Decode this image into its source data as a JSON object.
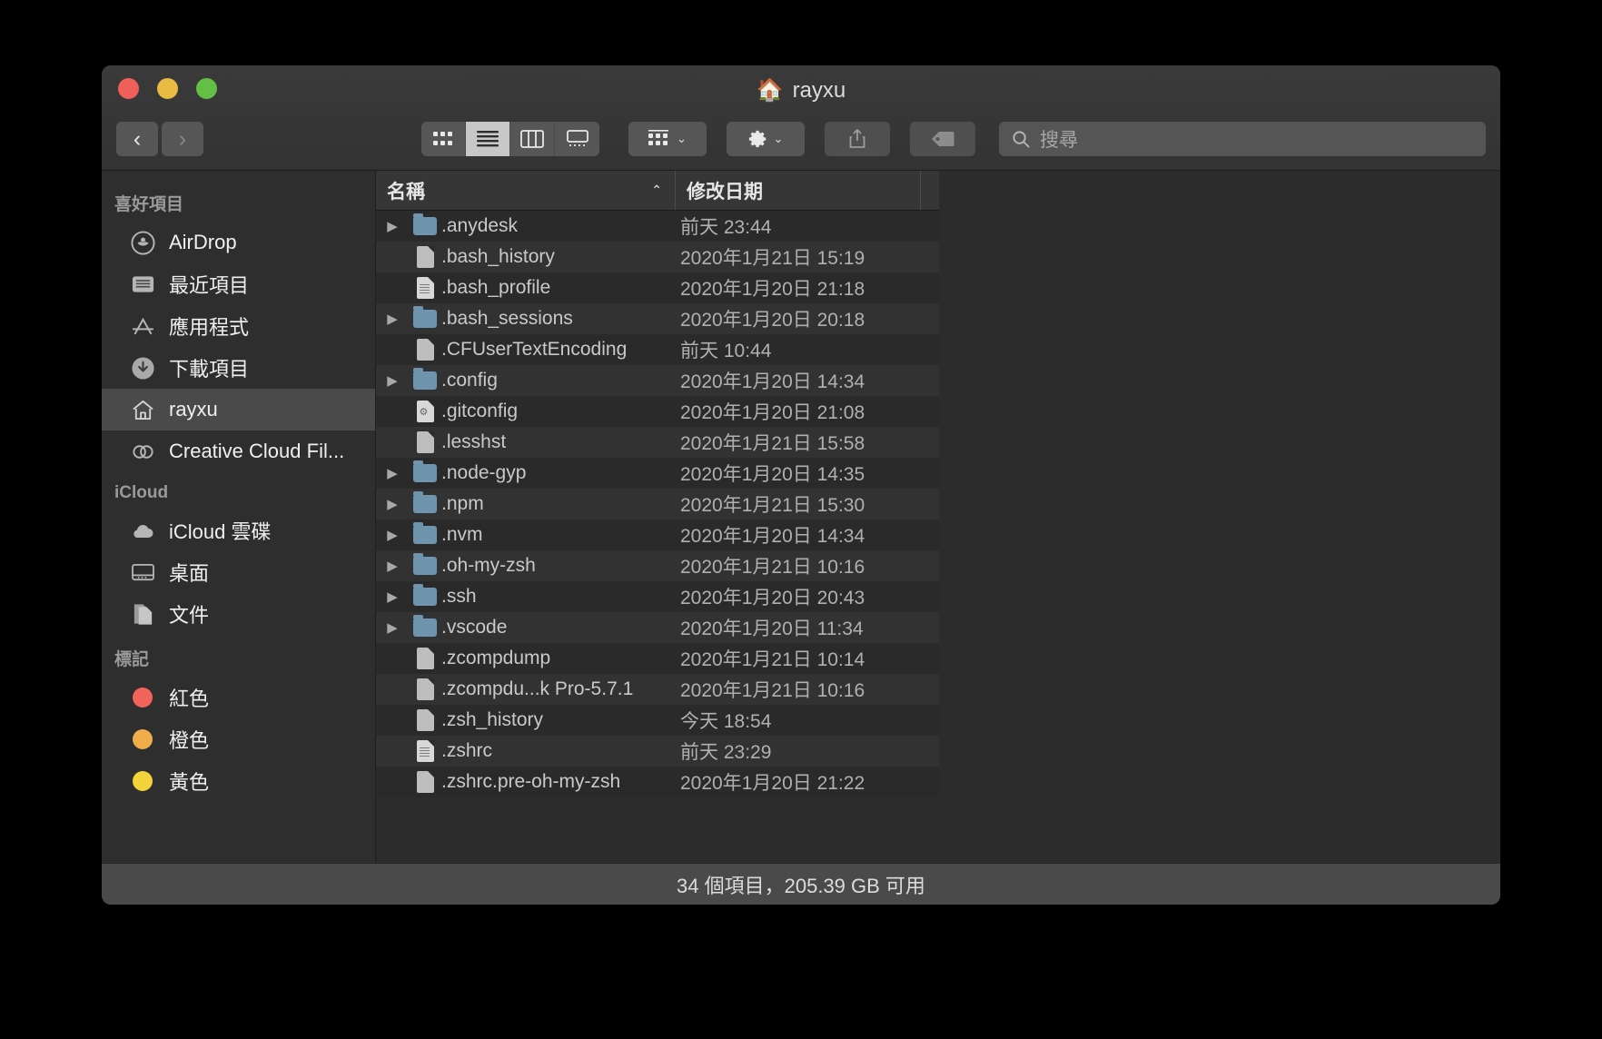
{
  "window": {
    "title": "rayxu",
    "title_icon": "home-icon"
  },
  "toolbar": {
    "back_label": "‹",
    "forward_label": "›",
    "view_buttons": [
      {
        "name": "icon-view",
        "label": "",
        "active": false
      },
      {
        "name": "list-view",
        "label": "",
        "active": true
      },
      {
        "name": "column-view",
        "label": "",
        "active": false
      },
      {
        "name": "gallery-view",
        "label": "",
        "active": false
      }
    ],
    "group_button": "group-by-button",
    "action_button": "action-gear-button",
    "share_button": "share-button",
    "tag_button": "tag-button",
    "search": {
      "placeholder": "搜尋",
      "value": ""
    }
  },
  "sidebar": {
    "sections": [
      {
        "header": "喜好項目",
        "items": [
          {
            "label": "AirDrop",
            "icon": "airdrop-icon",
            "selected": false
          },
          {
            "label": "最近項目",
            "icon": "recents-icon",
            "selected": false
          },
          {
            "label": "應用程式",
            "icon": "applications-icon",
            "selected": false
          },
          {
            "label": "下載項目",
            "icon": "downloads-icon",
            "selected": false
          },
          {
            "label": "rayxu",
            "icon": "home-icon",
            "selected": true
          },
          {
            "label": "Creative Cloud Fil...",
            "icon": "creative-cloud-icon",
            "selected": false
          }
        ]
      },
      {
        "header": "iCloud",
        "items": [
          {
            "label": "iCloud 雲碟",
            "icon": "cloud-icon",
            "selected": false
          },
          {
            "label": "桌面",
            "icon": "desktop-icon",
            "selected": false
          },
          {
            "label": "文件",
            "icon": "documents-icon",
            "selected": false
          }
        ]
      },
      {
        "header": "標記",
        "items": [
          {
            "label": "紅色",
            "icon": "tag-dot-icon",
            "color": "#f0645c",
            "selected": false
          },
          {
            "label": "橙色",
            "icon": "tag-dot-icon",
            "color": "#f0ad4c",
            "selected": false
          },
          {
            "label": "黃色",
            "icon": "tag-dot-icon",
            "color": "#f2d33c",
            "selected": false
          }
        ]
      }
    ]
  },
  "filelist": {
    "columns": {
      "name": "名稱",
      "date": "修改日期",
      "sort_indicator": "▲"
    },
    "rows": [
      {
        "name": ".anydesk",
        "date": "前天 23:44",
        "type": "folder",
        "expandable": true
      },
      {
        "name": ".bash_history",
        "date": "2020年1月21日 15:19",
        "type": "file",
        "expandable": false
      },
      {
        "name": ".bash_profile",
        "date": "2020年1月20日 21:18",
        "type": "doc",
        "expandable": false
      },
      {
        "name": ".bash_sessions",
        "date": "2020年1月20日 20:18",
        "type": "folder",
        "expandable": true
      },
      {
        "name": ".CFUserTextEncoding",
        "date": "前天 10:44",
        "type": "file",
        "expandable": false
      },
      {
        "name": ".config",
        "date": "2020年1月20日 14:34",
        "type": "folder",
        "expandable": true
      },
      {
        "name": ".gitconfig",
        "date": "2020年1月20日 21:08",
        "type": "gear",
        "expandable": false
      },
      {
        "name": ".lesshst",
        "date": "2020年1月21日 15:58",
        "type": "file",
        "expandable": false
      },
      {
        "name": ".node-gyp",
        "date": "2020年1月20日 14:35",
        "type": "folder",
        "expandable": true
      },
      {
        "name": ".npm",
        "date": "2020年1月21日 15:30",
        "type": "folder",
        "expandable": true
      },
      {
        "name": ".nvm",
        "date": "2020年1月20日 14:34",
        "type": "folder",
        "expandable": true
      },
      {
        "name": ".oh-my-zsh",
        "date": "2020年1月21日 10:16",
        "type": "folder",
        "expandable": true
      },
      {
        "name": ".ssh",
        "date": "2020年1月20日 20:43",
        "type": "folder",
        "expandable": true
      },
      {
        "name": ".vscode",
        "date": "2020年1月20日 11:34",
        "type": "folder",
        "expandable": true
      },
      {
        "name": ".zcompdump",
        "date": "2020年1月21日 10:14",
        "type": "file",
        "expandable": false
      },
      {
        "name": ".zcompdu...k Pro-5.7.1",
        "date": "2020年1月21日 10:16",
        "type": "file",
        "expandable": false
      },
      {
        "name": ".zsh_history",
        "date": "今天 18:54",
        "type": "file",
        "expandable": false
      },
      {
        "name": ".zshrc",
        "date": "前天 23:29",
        "type": "doc",
        "expandable": false
      },
      {
        "name": ".zshrc.pre-oh-my-zsh",
        "date": "2020年1月20日 21:22",
        "type": "file",
        "expandable": false
      }
    ]
  },
  "statusbar": {
    "text": "34 個項目，205.39 GB 可用"
  }
}
